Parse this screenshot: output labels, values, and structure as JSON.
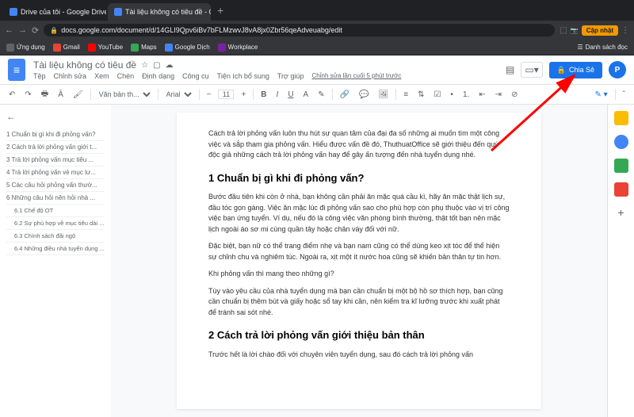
{
  "browser": {
    "tabs": [
      {
        "label": "Drive của tôi - Google Drive"
      },
      {
        "label": "Tài liệu không có tiêu đề - Go..."
      }
    ],
    "url": "docs.google.com/document/d/14GLI9Qpv6iBv7bFLMzwvJ8vA8jx0Zbr56qeAdveuabg/edit",
    "update_btn": "Cập nhật",
    "reading_list": "Danh sách đọc",
    "bookmarks": [
      {
        "label": "Ứng dụng"
      },
      {
        "label": "Gmail"
      },
      {
        "label": "YouTube"
      },
      {
        "label": "Maps"
      },
      {
        "label": "Google Dịch"
      },
      {
        "label": "Workplace"
      }
    ]
  },
  "docs": {
    "title": "Tài liệu không có tiêu đề",
    "menus": [
      "Tệp",
      "Chỉnh sửa",
      "Xem",
      "Chèn",
      "Định dạng",
      "Công cụ",
      "Tiện ích bổ sung",
      "Trợ giúp"
    ],
    "edit_history": "Chỉnh sửa lần cuối 5 phút trước",
    "share_label": "Chia Sẻ",
    "avatar_letter": "P"
  },
  "toolbar": {
    "style": "Văn bản th...",
    "font": "Arial",
    "size": "11"
  },
  "outline": {
    "items": [
      "1 Chuẩn bị gì khi đi phỏng vấn?",
      "2 Cách trả lời phỏng vấn giới t...",
      "3 Trả lời phỏng vấn mục tiêu ...",
      "4 Trả lời phỏng vấn vẻ mục lư...",
      "5 Các câu hỏi phỏng vấn thườ...",
      "6 Những câu hỏi nên hỏi nhà ..."
    ],
    "subitems": [
      "6.1 Chế độ OT",
      "6.2 Sự phù hợp về mục tiêu dài ...",
      "6.3 Chính sách đãi ngộ",
      "6.4 Những điều nhà tuyển dụng ..."
    ]
  },
  "content": {
    "intro": "Cách trả lời phỏng vấn luôn thu hút sự quan tâm của đại đa số những ai muốn tìm một công việc và sắp tham gia phỏng vấn. Hiểu được vấn đề đó, ThuthuatOffice sẽ giới thiệu đến quý độc giả những cách trả lời phỏng vấn hay để gây ấn tượng đến nhà tuyển dụng nhé.",
    "h1": "1 Chuẩn bị gì khi đi phỏng vấn?",
    "p1": "Bước đầu tiên khi còn ở nhà, bạn không cần phải ăn mặc quá cầu kì, hãy ăn mặc thật lịch sự, đầu tóc gọn gàng. Việc ăn mặc lúc đi phỏng vấn sao cho phù hợp còn phụ thuộc vào vị trí công việc bạn ứng tuyển. Ví dụ, nếu đó là công việc văn phòng bình thường, thật tốt bạn nên mặc lịch ngoài áo sơ mi cùng quần tây hoặc chân váy đối với nữ.",
    "p2": "Đặc biệt, bạn nữ có thể trang điểm nhẹ và bạn nam cũng có thể dùng keo xịt tóc để thể hiện sự chỉnh chu và nghiêm túc. Ngoài ra, xịt một ít nước hoa cũng sẽ khiến bản thân tự tin hơn.",
    "p3": "Khi phỏng vấn thì mang theo những gì?",
    "p4": "Tùy vào yêu cầu của nhà tuyển dụng mà bạn cần chuẩn bị một bộ hồ sơ thích hợp, bạn cũng cần chuẩn bị thêm bút và giấy hoặc sổ tay khi cần, nên kiểm tra kĩ lưỡng trước khi xuất phát để tránh sai sót nhé.",
    "h2": "2 Cách trả lời phỏng vấn giới thiệu bản thân",
    "p5": "Trước hết là lời chào đối với chuyên viên tuyển dụng, sau đó cách trả lời phỏng vấn"
  }
}
